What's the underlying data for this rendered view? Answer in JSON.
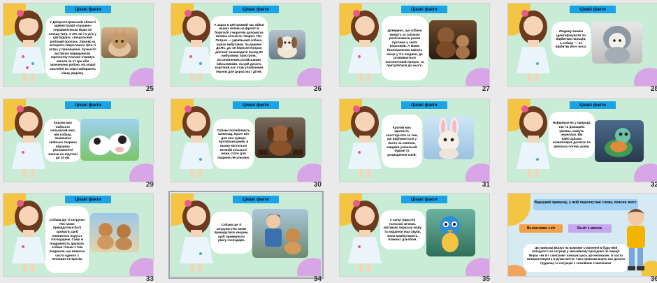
{
  "slides": [
    {
      "n": "25",
      "kind": "fact",
      "title": "Цікаві факти",
      "photo": "kitten",
      "text": "У Дніпропетровській області адміністрації «працює» справжнісінька кішка по кличці Тигр. У неї, як і в усіх у цій будівлі, спеціальний робочий пропуск. Люкові на колорито-сверстаного фон ті котра у приміщенні, пухнасто зустрічає відвідувачів. Зарплатну платню отримує хинати за ет кри обо запечечено робою. На кошні численні по черзі забирають кішку додому."
    },
    {
      "n": "26",
      "kind": "fact",
      "title": "Цікаві факти",
      "photo": "dog",
      "text": "А зараз в цей важкий час війни наших воїнів на фронті в боротьбі з ворогом допомагає велика кількість тварин. Пес Патрон — українький собака-шукач вибухівки. За даними ДСНС, до 19 березня Патрон допоміг знешкодити понад 90 вибухових пристроїв, встановлених російськими військовими. За цей досить короткий час став улюбленим героєм для дорослих і дітей."
    },
    {
      "n": "27",
      "kind": "fact",
      "title": "Цікаві факти",
      "photo": "dog-cat",
      "text": "Доведено, що собаки можуть за запахом розпізнавати рахов пухлини у своїх власників. А кішки безпомилково вміють місце у тіл людини, де розвивається патологічний процес, та притулятися до нього."
    },
    {
      "n": "28",
      "kind": "fact",
      "title": "Цікаві факти",
      "photo": "puppy-hood",
      "text": "Людину можна ідентифікувати по відбитках пальців, а собаку — по відбитку його носа."
    },
    {
      "n": "29",
      "kind": "fact",
      "title": "Цікаві факти",
      "photo": "cows",
      "text": "Корова має набагато сильніший нюх, ніж собака. Зазначена свійська тварина відчуває різноманітні запахи на відстані до 10 км."
    },
    {
      "n": "30",
      "kind": "fact",
      "title": "Цікаві факти",
      "photo": "choc-dog",
      "text": "Собаки полюбляють шоколад, проте він для них суворо протипоказаний, в ньому міститься великій кількості може стати для тварини летальним."
    },
    {
      "n": "31",
      "kind": "fact",
      "title": "Цікаві факти",
      "photo": "bunny",
      "text": "Кролик має здатність спостерігати за тим, що відбувається у нього за спиною, завдяки унікальній будові та розміщенню очей."
    },
    {
      "n": "32",
      "kind": "fact",
      "title": "Цікаві факти",
      "photo": "turtle",
      "text": "Найдовше як у природі, так і в домашніх умовах, живуть черепахи. Вік найстаріших екземплярів досягає по декілька сотень років."
    },
    {
      "n": "33",
      "kind": "fact",
      "title": "Цікаві факти",
      "photo": "two-dogs",
      "text": "Собаки ще ті хитруни! Пес може прикидатися болі хромати, щоб опинитись поруч з господарем. Сама ж подружність дружать собака тільки з тим людиною, що вимагає часто одного з головних інтересів."
    },
    {
      "n": "34",
      "kind": "fact",
      "title": "Цікаві факти",
      "photo": "boy-dog",
      "text": "Собаки ще ті хитруни! Пес може прикидатися хворим, щоб привернути увагу господаря."
    },
    {
      "n": "35",
      "kind": "fact",
      "title": "Цікаві факти",
      "photo": "parrot",
      "text": "У папуг відсутні голосові зв'язки. Імітуючи людську мову та видаючи інші звуки, вони маніпулюють язиком і дзьобом."
    },
    {
      "n": "36",
      "kind": "task",
      "banner": "Відшукай приказку, у якій переплутані слова, поясни зміст.",
      "opt1": "Як мисливе з кіт",
      "opt2": "Як кіт з мисли.",
      "text": "Ця приказка вказує на важливе ставлення в будь-якій складності чи ситуації у звичайному прохідних по інерції. Вираз «як кіт з мислом» означає щось ще непоказне, їх часто використовують в руках життя. Така приказка вчить нас долати труднощі та ситуацію з спокійним ставленням."
    }
  ],
  "colors": {
    "bg": "#c9ecd7",
    "title": "#1aa3e8",
    "bubble": "#ffffff",
    "yellow": "#f4c542",
    "purple": "#d8a6e6",
    "orange": "#f3a35d"
  }
}
